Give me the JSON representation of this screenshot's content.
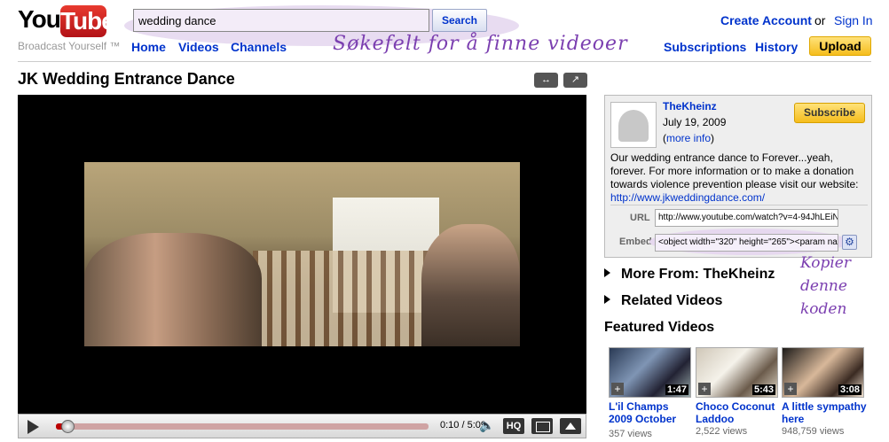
{
  "header": {
    "logo_you": "You",
    "logo_tube": "Tube",
    "tagline": "Broadcast Yourself ™",
    "search_value": "wedding dance",
    "search_button": "Search",
    "search_annotation": "Søkefelt for å finne videoer",
    "nav": {
      "home": "Home",
      "videos": "Videos",
      "channels": "Channels"
    },
    "create_account": "Create Account",
    "or": "or",
    "sign_in": "Sign In",
    "subscriptions": "Subscriptions",
    "history": "History",
    "upload": "Upload"
  },
  "video": {
    "title": "JK Wedding Entrance Dance",
    "time": "0:10 / 5:09",
    "progress": 0.032,
    "hq_label": "HQ"
  },
  "channel": {
    "name": "TheKheinz",
    "date": "July 19, 2009",
    "more_info_open": "(",
    "more_info": "more info",
    "more_info_close": ")",
    "subscribe": "Subscribe",
    "description": "Our wedding entrance dance to Forever...yeah, forever. For more information or to make a donation towards violence prevention please visit our website:",
    "link": "http://www.jkweddingdance.com/",
    "url_label": "URL",
    "url_value": "http://www.youtube.com/watch?v=4-94JhLEiN",
    "embed_label": "Embed",
    "embed_value": "<object width=\"320\" height=\"265\"><param na"
  },
  "copy_annotation": [
    "Kopier",
    "denne",
    "koden"
  ],
  "sidebar": {
    "more_from": "More From: TheKheinz",
    "related": "Related Videos",
    "featured": "Featured Videos"
  },
  "featured_videos": [
    {
      "title": "L'il Champs 2009 October",
      "views": "357 views",
      "duration": "1:47"
    },
    {
      "title": "Choco Coconut Laddoo",
      "views": "2,522 views",
      "duration": "5:43"
    },
    {
      "title": "A little sympathy here",
      "views": "948,759 views",
      "duration": "3:08"
    }
  ]
}
